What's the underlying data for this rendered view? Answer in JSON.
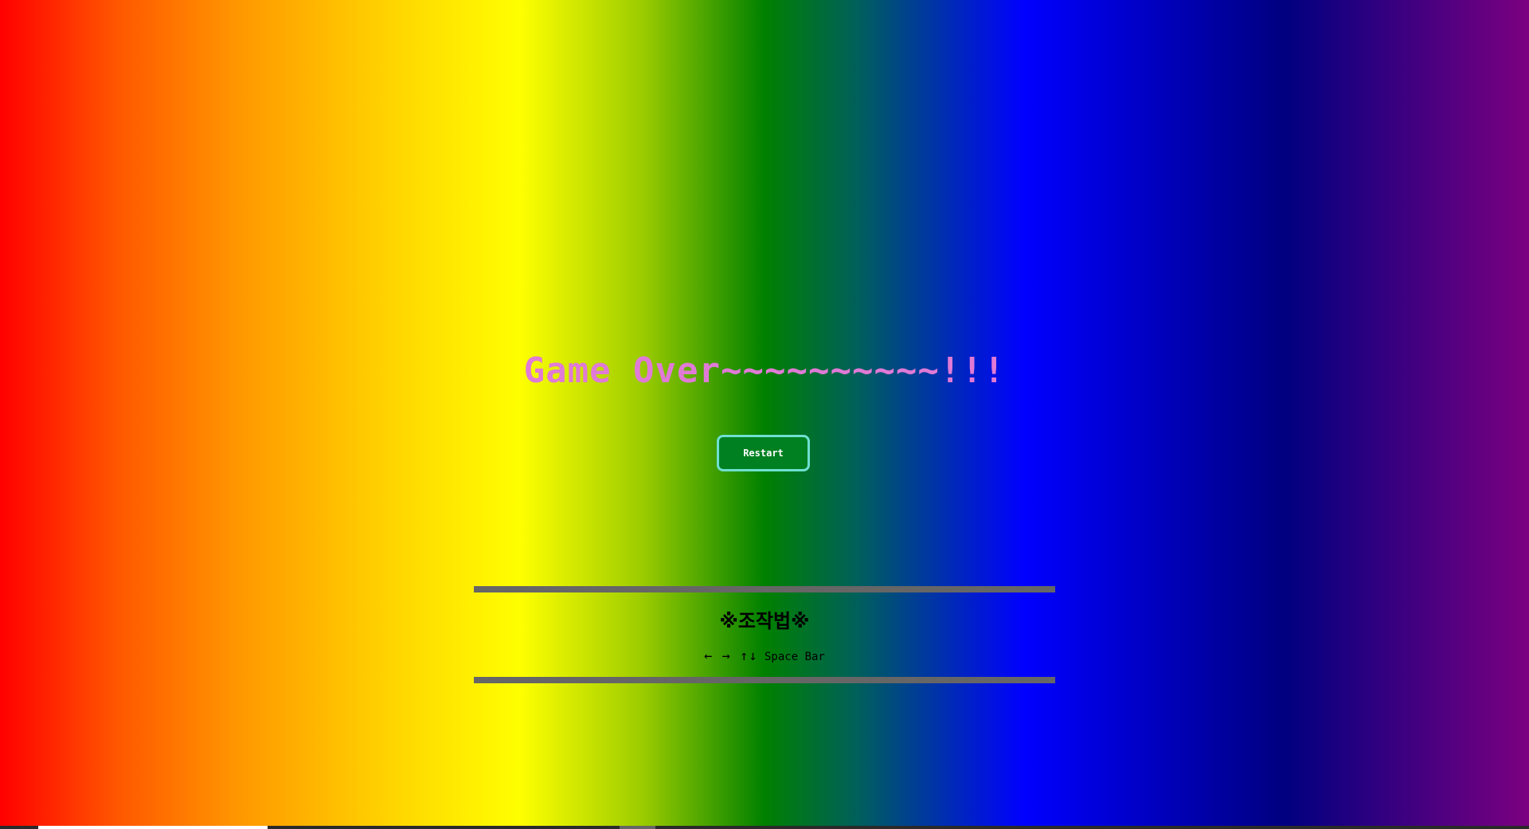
{
  "game": {
    "title": "Game Over~~~~~~~~~~!!!",
    "restart_label": "Restart"
  },
  "controls": {
    "heading": "※조작법※",
    "arrows": "← → ↑↓",
    "space_label": "Space Bar"
  },
  "colors": {
    "title": "#e07ad6",
    "button_bg": "#008020",
    "button_border": "#6fe0d0",
    "divider": "#666666"
  }
}
